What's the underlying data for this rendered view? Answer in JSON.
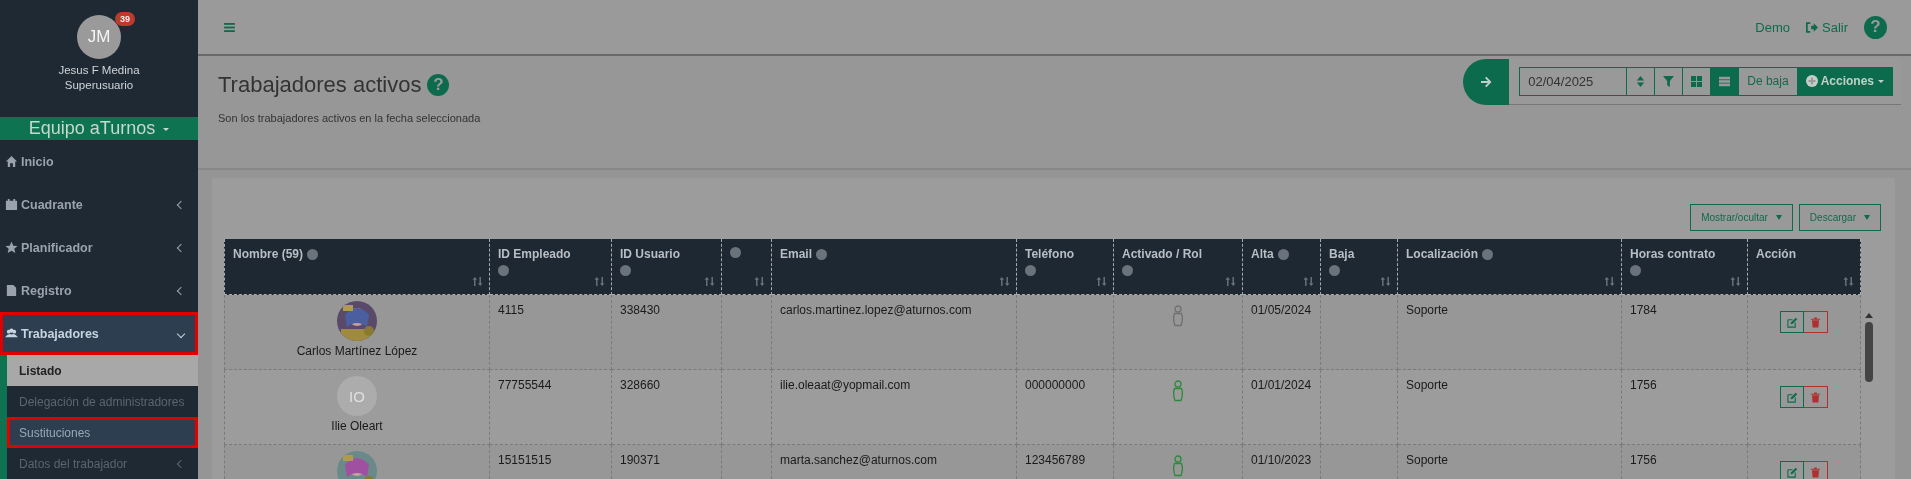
{
  "user": {
    "initials": "JM",
    "badge": "39",
    "name": "Jesus F Medina",
    "role": "Superusuario"
  },
  "team": {
    "label": "Equipo aTurnos"
  },
  "sidebar": {
    "items": [
      {
        "label": "Inicio",
        "selected": false,
        "highlighted": false,
        "has_submenu": false
      },
      {
        "label": "Cuadrante",
        "selected": false,
        "highlighted": false,
        "has_submenu": true
      },
      {
        "label": "Planificador",
        "selected": false,
        "highlighted": false,
        "has_submenu": true
      },
      {
        "label": "Registro",
        "selected": false,
        "highlighted": false,
        "has_submenu": true
      },
      {
        "label": "Trabajadores",
        "selected": true,
        "highlighted": true,
        "has_submenu": true,
        "expanded": true,
        "children": [
          {
            "label": "Listado",
            "selected": true,
            "highlighted": false,
            "has_submenu": false
          },
          {
            "label": "Delegación de administradores",
            "selected": false,
            "highlighted": false,
            "has_submenu": false
          },
          {
            "label": "Sustituciones",
            "selected": false,
            "highlighted": true,
            "has_submenu": false
          },
          {
            "label": "Datos del trabajador",
            "selected": false,
            "highlighted": false,
            "has_submenu": true
          }
        ]
      }
    ]
  },
  "topbar": {
    "demo": "Demo",
    "logout": "Salir",
    "help": "?"
  },
  "page": {
    "title": "Trabajadores activos",
    "help": "?",
    "subtitle": "Son los trabajadores activos en la fecha seleccionada"
  },
  "toolbar": {
    "date": "02/04/2025",
    "views": [
      {
        "kind": "grid",
        "selected": false
      },
      {
        "kind": "list",
        "selected": true
      }
    ],
    "inactive": "De baja",
    "actions": "Acciones"
  },
  "table_buttons": [
    "Mostrar/ocultar",
    "Descargar"
  ],
  "table": {
    "columns": [
      {
        "label": "Nombre (59)",
        "info": true,
        "info_below": false
      },
      {
        "label": "ID Empleado",
        "info": true,
        "info_below": true
      },
      {
        "label": "ID Usuario",
        "info": true,
        "info_below": true
      },
      {
        "info": true,
        "info_below": false
      },
      {
        "label": "Email",
        "info": true,
        "info_below": false
      },
      {
        "label": "Teléfono",
        "info": true,
        "info_below": true
      },
      {
        "label": "Activado / Rol",
        "info": true,
        "info_below": true
      },
      {
        "label": "Alta",
        "info": true,
        "info_below": false
      },
      {
        "label": "Baja",
        "info": true,
        "info_below": true
      },
      {
        "label": "Localización",
        "info": true,
        "info_below": false
      },
      {
        "label": "Horas contrato",
        "info": true,
        "info_below": true
      },
      {
        "label": "Acción",
        "info": false
      }
    ],
    "rows": [
      {
        "name": "Carlos Martínez López",
        "employee_id": "4115",
        "user_id": "338430",
        "email": "carlos.martinez.lopez@aturnos.com",
        "phone": "",
        "activated": false,
        "start": "01/05/2024",
        "end": "",
        "location": "Soporte",
        "hours": "1784"
      },
      {
        "avatar": {
          "kind": "initials",
          "initials": "IO"
        },
        "name": "Ilie Oleart",
        "employee_id": "77755544",
        "user_id": "328660",
        "email": "ilie.oleaat@yopmail.com",
        "phone": "000000000",
        "activated": true,
        "start": "01/01/2024",
        "end": "",
        "location": "Soporte",
        "hours": "1756"
      },
      {
        "employee_id": "15151515",
        "user_id": "190371",
        "email": "marta.sanchez@aturnos.com",
        "phone": "123456789",
        "activated": true,
        "start": "01/10/2023",
        "end": "",
        "location": "Soporte",
        "hours": "1756"
      }
    ]
  }
}
